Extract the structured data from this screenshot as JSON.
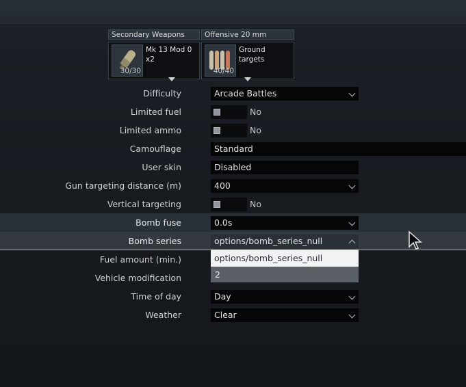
{
  "weapons": {
    "slot1": {
      "header": "Secondary Weapons",
      "name_line1": "Mk 13 Mod 0",
      "name_line2": "x2",
      "count": "30/30",
      "icon": "torpedo-icon"
    },
    "slot2": {
      "header": "Offensive 20 mm",
      "name_line1": "Ground",
      "name_line2": "targets",
      "count": "40/40",
      "icon": "ammo-belt-icon"
    }
  },
  "settings": {
    "difficulty": {
      "label": "Difficulty",
      "value": "Arcade Battles"
    },
    "limited_fuel": {
      "label": "Limited fuel",
      "value": "No"
    },
    "limited_ammo": {
      "label": "Limited ammo",
      "value": "No"
    },
    "camouflage": {
      "label": "Camouflage",
      "value": "Standard"
    },
    "user_skin": {
      "label": "User skin",
      "value": "Disabled"
    },
    "gun_targeting": {
      "label": "Gun targeting distance (m)",
      "value": "400"
    },
    "vertical_targeting": {
      "label": "Vertical targeting",
      "value": "No"
    },
    "bomb_fuse": {
      "label": "Bomb fuse",
      "value": "0.0s"
    },
    "bomb_series": {
      "label": "Bomb series",
      "value": "options/bomb_series_null",
      "options": [
        "options/bomb_series_null",
        "2"
      ]
    },
    "fuel_amount": {
      "label": "Fuel amount (min.)"
    },
    "vehicle_modification": {
      "label": "Vehicle modification"
    },
    "time_of_day": {
      "label": "Time of day",
      "value": "Day"
    },
    "weather": {
      "label": "Weather",
      "value": "Clear"
    }
  },
  "colors": {
    "background": "#171b20",
    "highlight_row": "#2a3037",
    "dropdown_selected": "#f1f2f3"
  }
}
